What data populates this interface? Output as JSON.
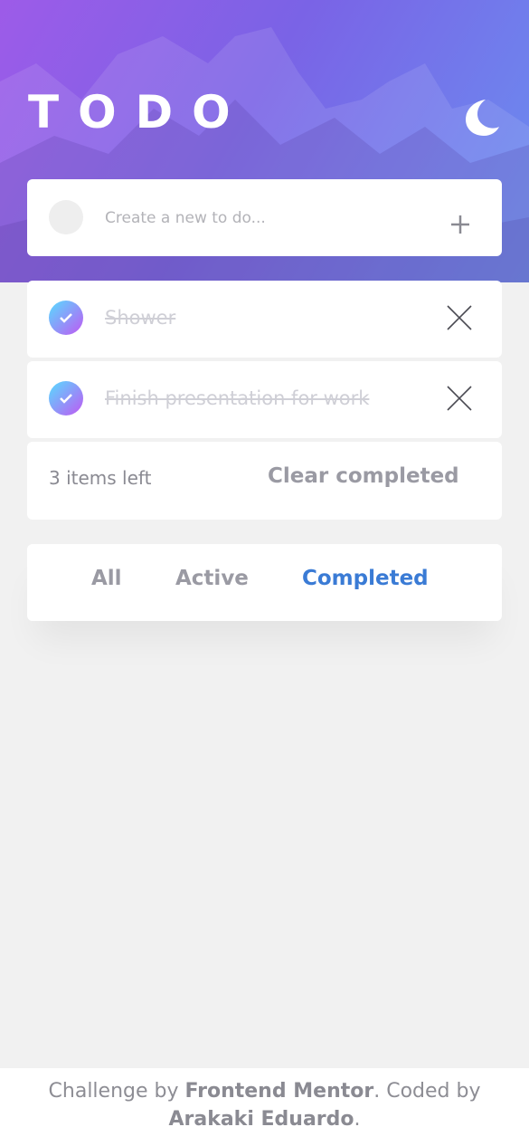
{
  "app": {
    "title": "TODO",
    "accent_color": "#3a7bd5",
    "check_gradient": [
      "#57ddff",
      "#c058f3"
    ]
  },
  "header": {
    "theme_toggle_icon": "moon-icon"
  },
  "new_todo": {
    "placeholder": "Create a new to do...",
    "value": "",
    "add_icon": "plus-icon"
  },
  "todos": [
    {
      "text": "Shower",
      "completed": true,
      "delete_icon": "close-icon"
    },
    {
      "text": "Finish presentation for work",
      "completed": true,
      "delete_icon": "close-icon"
    }
  ],
  "footer": {
    "items_left": "3 items left",
    "clear_label": "Clear completed"
  },
  "filters": {
    "all": "All",
    "active": "Active",
    "completed": "Completed",
    "selected": "completed"
  },
  "attribution": {
    "prefix": "Challenge by ",
    "frontend_mentor": "Frontend Mentor",
    "middle": ". Coded by ",
    "author": "Arakaki Eduardo",
    "suffix": "."
  }
}
